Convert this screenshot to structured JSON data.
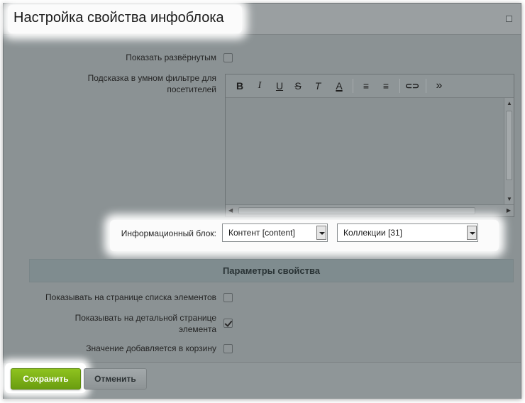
{
  "dialog": {
    "title": "Настройка свойства инфоблока"
  },
  "fields": {
    "show_expanded_label": "Показать развёрнутым",
    "show_expanded_checked": false,
    "hint_label": "Подсказка в умном фильтре для посетителей",
    "iblock_label": "Информационный блок:",
    "iblock_type_value": "Контент [content]",
    "iblock_value": "Коллекции [31]"
  },
  "editor": {
    "toolbar": [
      {
        "name": "bold-icon",
        "glyph": "B"
      },
      {
        "name": "italic-icon",
        "glyph": "I"
      },
      {
        "name": "underline-icon",
        "glyph": "U"
      },
      {
        "name": "strikethrough-icon",
        "glyph": "S"
      },
      {
        "name": "remove-format-icon",
        "glyph": "T"
      },
      {
        "name": "font-color-icon",
        "glyph": "A"
      },
      {
        "name": "ordered-list-icon",
        "glyph": "≡"
      },
      {
        "name": "unordered-list-icon",
        "glyph": "≡"
      },
      {
        "name": "link-icon",
        "glyph": "⊂⊃"
      },
      {
        "name": "more-icon",
        "glyph": "»"
      }
    ],
    "content": ""
  },
  "section": {
    "title": "Параметры свойства"
  },
  "params": {
    "show_in_list_label": "Показывать на странице списка элементов",
    "show_in_list_checked": false,
    "show_in_detail_label": "Показывать на детальной странице элемента",
    "show_in_detail_checked": true,
    "add_to_basket_label": "Значение добавляется в корзину",
    "add_to_basket_checked": false
  },
  "buttons": {
    "save": "Сохранить",
    "cancel": "Отменить"
  },
  "colors": {
    "save_button": "#7cb518",
    "overlay": "#8b9294",
    "section_header": "#7f8c8f"
  }
}
